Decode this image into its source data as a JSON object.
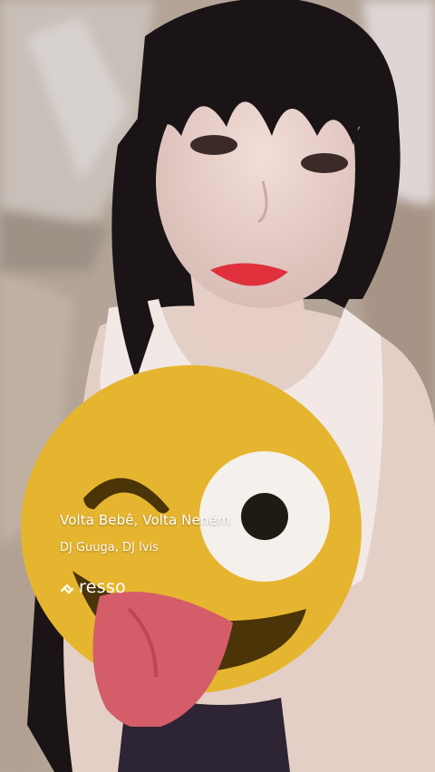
{
  "song": {
    "title": "Volta Bebê, Volta Neném",
    "artist": "DJ Guuga, DJ Ivis"
  },
  "brand": {
    "name": "resso",
    "icon": "resso-logo-icon"
  },
  "sticker": {
    "icon": "winking-tongue-out-emoji-icon",
    "face_color": "#e6b52f",
    "tongue_color": "#d45d6a"
  },
  "colors": {
    "text": "#ffffff"
  }
}
